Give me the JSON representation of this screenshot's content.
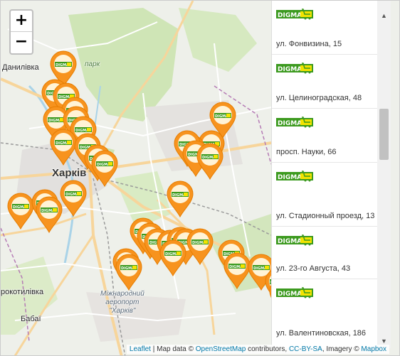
{
  "zoom": {
    "in_label": "+",
    "out_label": "−"
  },
  "places": {
    "danylivka": "Данилівка",
    "park": "парк",
    "kharkiv": "Харків",
    "rokotylivka": "рокотилівка",
    "babai": "Бабаї",
    "airport_line1": "Міжнародний",
    "airport_line2": "аеропорт",
    "airport_line3": "\"Харків\""
  },
  "marker": {
    "brand": "DIGMA",
    "count_visible": 41,
    "color": "#f7931e"
  },
  "stores": [
    {
      "brand": "DIGMA",
      "address": "ул. Фонвизина, 15"
    },
    {
      "brand": "DIGMA",
      "address": "ул. Целиноградская, 48"
    },
    {
      "brand": "DIGMA",
      "address": "просп. Науки, 66"
    },
    {
      "brand": "DIGMA",
      "address": "ул. Стадионный проезд, 13"
    },
    {
      "brand": "DIGMA",
      "address": "ул. 23-го Августа, 43"
    },
    {
      "brand": "DIGMA",
      "address": "ул. Валентиновская, 186"
    }
  ],
  "scroll": {
    "up": "▲",
    "down": "▼"
  },
  "attribution": {
    "leaflet": "Leaflet",
    "sep1": " | Map data © ",
    "osm": "OpenStreetMap",
    "sep2": " contributors, ",
    "license": "CC-BY-SA",
    "sep3": ", Imagery © ",
    "mapbox": "Mapbox"
  },
  "colors": {
    "marker_orange": "#f7931e",
    "logo_green": "#3c9a1f",
    "logo_yellow": "#f2e300",
    "link": "#0078a8"
  }
}
